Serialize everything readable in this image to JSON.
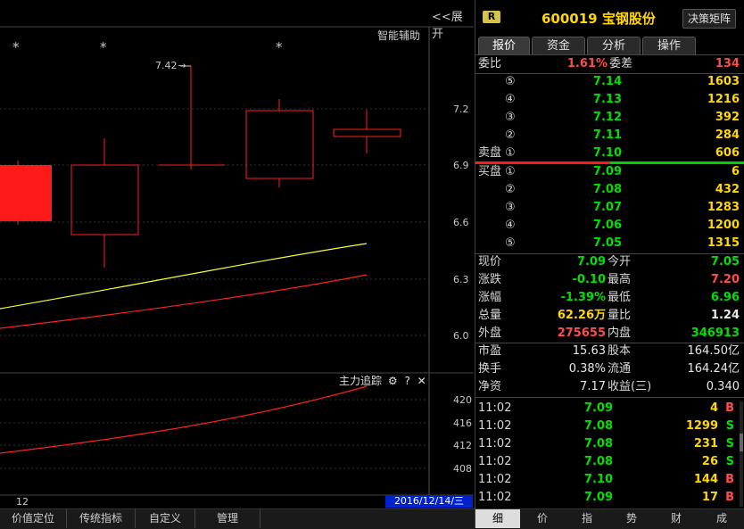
{
  "chart": {
    "expand_label": "<<展开",
    "smart_label": "智能辅助",
    "high_marker": "7.42",
    "price_ticks": [
      "7.2",
      "6.9",
      "6.6",
      "6.3",
      "6.0"
    ],
    "sub_title": "主力追踪",
    "sub_ticks": [
      "420",
      "416",
      "412",
      "408"
    ],
    "date": "2016/12/14/三",
    "bottom_num": "12",
    "stars": [
      "*",
      "*",
      "*"
    ],
    "colors": {
      "up": "#ff2020",
      "down": "#ff2020",
      "ma1": "#ffff00",
      "ma2": "#ff2020"
    }
  },
  "bottom_tabs": [
    "价值定位",
    "传统指标",
    "自定义",
    "管理"
  ],
  "panel": {
    "badge": "R",
    "title": "600019 宝钢股份",
    "decision": "决策矩阵",
    "tabs": [
      "报价",
      "资金",
      "分析",
      "操作"
    ],
    "weibi_label": "委比",
    "weibi_value": "1.61%",
    "weicha_label": "委差",
    "weicha_value": "134",
    "sell": [
      {
        "label": "",
        "lvl": "⑤",
        "price": "7.14",
        "vol": "1603"
      },
      {
        "label": "",
        "lvl": "④",
        "price": "7.13",
        "vol": "1216"
      },
      {
        "label": "",
        "lvl": "③",
        "price": "7.12",
        "vol": "392"
      },
      {
        "label": "",
        "lvl": "②",
        "price": "7.11",
        "vol": "284"
      },
      {
        "label": "卖盘",
        "lvl": "①",
        "price": "7.10",
        "vol": "606"
      }
    ],
    "buy": [
      {
        "label": "买盘",
        "lvl": "①",
        "price": "7.09",
        "vol": "6"
      },
      {
        "label": "",
        "lvl": "②",
        "price": "7.08",
        "vol": "432"
      },
      {
        "label": "",
        "lvl": "③",
        "price": "7.07",
        "vol": "1283"
      },
      {
        "label": "",
        "lvl": "④",
        "price": "7.06",
        "vol": "1200"
      },
      {
        "label": "",
        "lvl": "⑤",
        "price": "7.05",
        "vol": "1315"
      }
    ],
    "quotes": [
      {
        "l1": "现价",
        "v1": "7.09",
        "c1": "green",
        "l2": "今开",
        "v2": "7.05",
        "c2": "green"
      },
      {
        "l1": "涨跌",
        "v1": "-0.10",
        "c1": "green",
        "l2": "最高",
        "v2": "7.20",
        "c2": "red"
      },
      {
        "l1": "涨幅",
        "v1": "-1.39%",
        "c1": "green",
        "l2": "最低",
        "v2": "6.96",
        "c2": "green"
      },
      {
        "l1": "总量",
        "v1": "62.26万",
        "c1": "yellow",
        "l2": "量比",
        "v2": "1.24",
        "c2": "white"
      },
      {
        "l1": "外盘",
        "v1": "275655",
        "c1": "red",
        "l2": "内盘",
        "v2": "346913",
        "c2": "green"
      }
    ],
    "fund": [
      {
        "l1": "市盈",
        "v1": "15.63",
        "l2": "股本",
        "v2": "164.50亿"
      },
      {
        "l1": "换手",
        "v1": "0.38%",
        "l2": "流通",
        "v2": "164.24亿"
      },
      {
        "l1": "净资",
        "v1": "7.17",
        "l2": "收益(三)",
        "v2": "0.340"
      }
    ],
    "ticks": [
      {
        "time": "11:02",
        "price": "7.09",
        "vol": "4",
        "flag": "B"
      },
      {
        "time": "11:02",
        "price": "7.08",
        "vol": "1299",
        "flag": "S"
      },
      {
        "time": "11:02",
        "price": "7.08",
        "vol": "231",
        "flag": "S"
      },
      {
        "time": "11:02",
        "price": "7.08",
        "vol": "26",
        "flag": "S"
      },
      {
        "time": "11:02",
        "price": "7.10",
        "vol": "144",
        "flag": "B"
      },
      {
        "time": "11:02",
        "price": "7.09",
        "vol": "17",
        "flag": "B"
      }
    ],
    "bottom": [
      "细",
      "价",
      "指",
      "势",
      "财",
      "成"
    ]
  }
}
